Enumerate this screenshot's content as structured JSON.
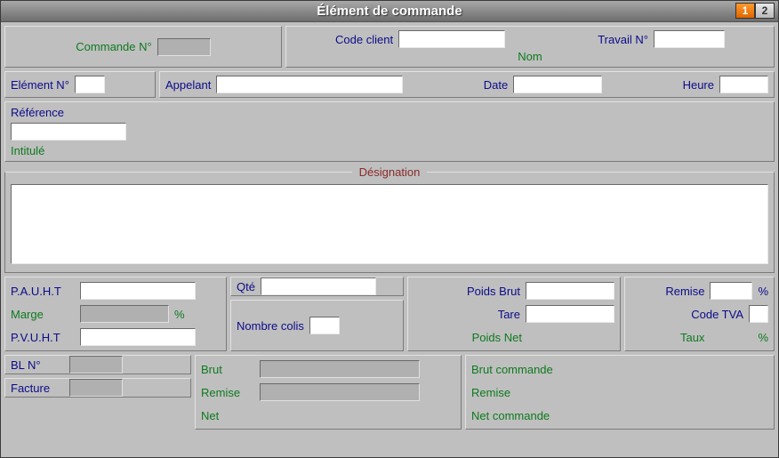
{
  "title": "Élément de commande",
  "pages": {
    "p1": "1",
    "p2": "2"
  },
  "header": {
    "commande_no": "Commande N°",
    "code_client": "Code client",
    "travail_no": "Travail N°",
    "nom": "Nom",
    "element_no": "Elément N°",
    "appelant": "Appelant",
    "date": "Date",
    "heure": "Heure"
  },
  "ref": {
    "reference": "Référence",
    "intitule": "Intitulé"
  },
  "designation_legend": "Désignation",
  "prices": {
    "pauht": "P.A.U.H.T",
    "marge": "Marge",
    "pvuht": "P.V.U.H.T",
    "percent": "%"
  },
  "qty": {
    "qte": "Qté",
    "nb_colis": "Nombre colis"
  },
  "weight": {
    "brut": "Poids Brut",
    "tare": "Tare",
    "net": "Poids Net"
  },
  "discount": {
    "remise": "Remise",
    "percent": "%",
    "code_tva": "Code TVA",
    "taux": "Taux"
  },
  "footer_left": {
    "bl_no": "BL N°",
    "facture": "Facture"
  },
  "footer_mid": {
    "brut": "Brut",
    "remise": "Remise",
    "net": "Net"
  },
  "footer_right": {
    "brut_cmd": "Brut commande",
    "remise": "Remise",
    "net_cmd": "Net commande"
  }
}
